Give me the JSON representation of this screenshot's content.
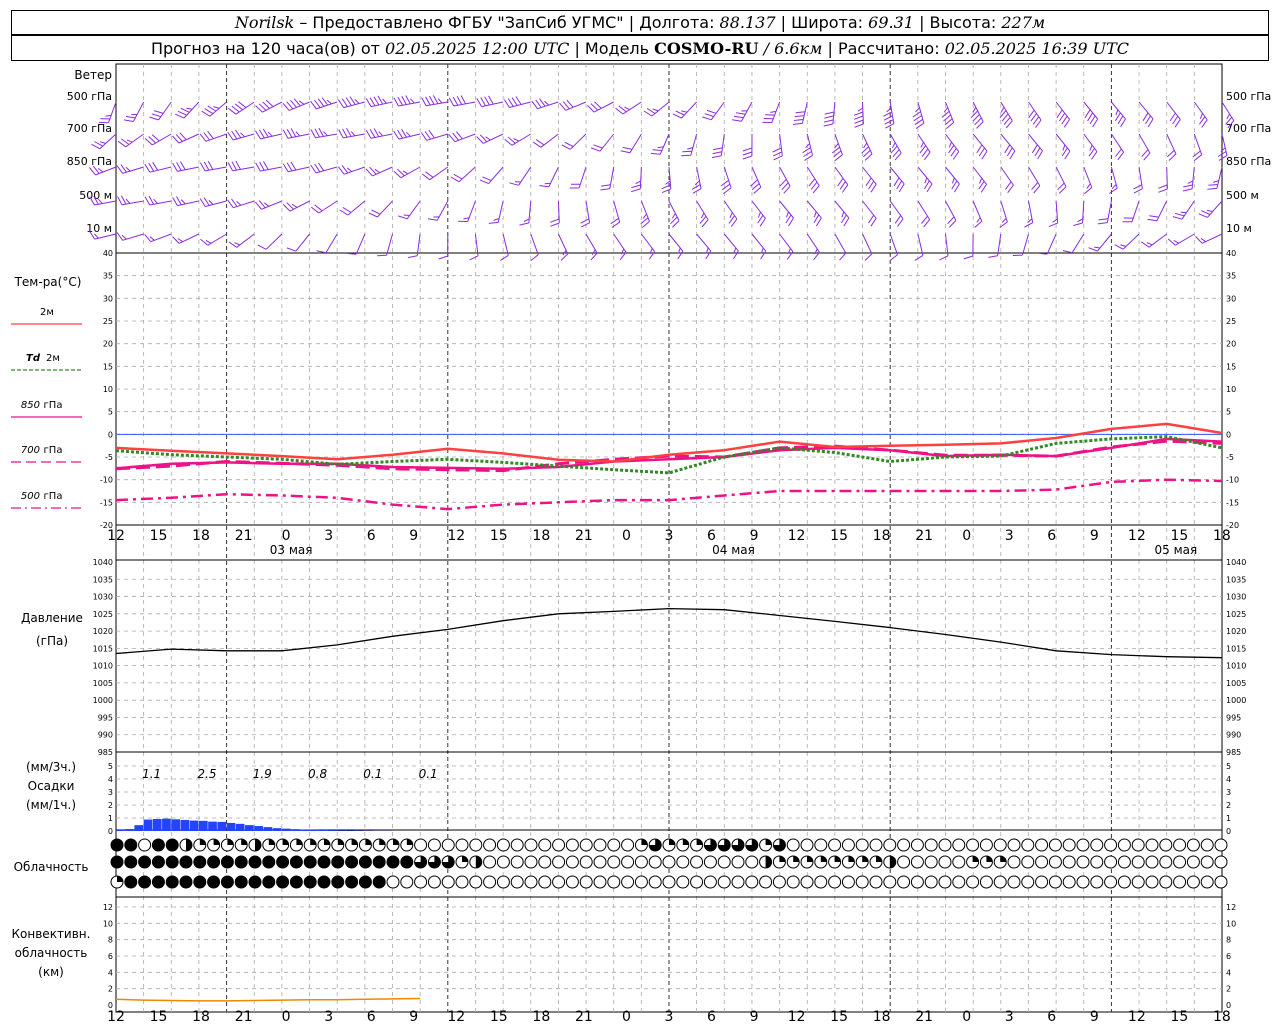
{
  "header": {
    "station": "Norilsk",
    "provider": "– Предоставлено ФГБУ \"ЗапСиб УГМС\"",
    "lon_label": "| Долгота:",
    "lon_value": "88.137",
    "lat_label": "| Широта:",
    "lat_value": "69.31",
    "alt_label": "| Высота:",
    "alt_value": "227м",
    "forecast_prefix": "Прогноз на 120 часа(ов) от",
    "forecast_date": "02.05.2025 12:00 UTC",
    "model_label": "| Модель",
    "model_name": "COSMO-RU",
    "model_res": "/ 6.6км",
    "calc_label": "| Рассчитано:",
    "calc_date": "02.05.2025 16:39 UTC"
  },
  "wind_panel": {
    "title": "Ветер",
    "levels": [
      "500 гПа",
      "700 гПа",
      "850 гПа",
      "500 м",
      "10 м"
    ],
    "right_levels": [
      "500 гПа",
      "700 гПа",
      "850 гПа",
      "500 м",
      "10 м"
    ],
    "barb_color": "#8a2be2"
  },
  "temp_panel": {
    "title": "Тем-ра(°C)",
    "legend": [
      {
        "prefix": "",
        "label": "2м",
        "color": "#ff4040",
        "dash": ""
      },
      {
        "prefix": "Td",
        "label": "2м",
        "color": "#2e8b22",
        "dash": "4,2"
      },
      {
        "prefix": "850",
        "label": "гПа",
        "color": "#ee1188",
        "dash": ""
      },
      {
        "prefix": "700",
        "label": "гПа",
        "color": "#ee1188",
        "dash": "10,5"
      },
      {
        "prefix": "500",
        "label": "гПа",
        "color": "#ee1188",
        "dash": "10,4,2,4"
      }
    ]
  },
  "time_axis": {
    "hour_labels": [
      "12",
      "15",
      "18",
      "21",
      "0",
      "3",
      "6",
      "9",
      "12",
      "15",
      "18",
      "21",
      "0",
      "3",
      "6",
      "9",
      "12",
      "15",
      "18",
      "21",
      "0",
      "3",
      "6",
      "9",
      "12",
      "15",
      "18"
    ],
    "day_labels": [
      "03 мая",
      "04 мая",
      "05 мая"
    ]
  },
  "pressure_panel": {
    "title_line1": "Давление",
    "title_line2": "(гПа)"
  },
  "precip_panel": {
    "title_line1": "(мм/3ч.)",
    "title_line2": "Осадки",
    "title_line3": "(мм/1ч.)",
    "totals_3h": [
      "1.1",
      "2.5",
      "1.9",
      "0.8",
      "0.1",
      "0.1"
    ],
    "bar_color": "#2244ff"
  },
  "cloud_panel": {
    "title": "Облачность",
    "rows": [
      "11.750.50.250.250.250.250.50.250.250.250.250.250.250.250.250.250.250.2500000000000000000.250.750.250.250.250.750.750.750.750.250.75000000000000000000000000000000000000000000",
      "11111111111111111111110.750.750.750.250.5000000000000000000000.50.250.250.250.250.250.250.250.250.5000000.250.250.25000000000000000000000000000000000",
      "0.25111111111111111111100000000000000000000000000000000000000000000000000000000000000000000000000000000000000"
    ]
  },
  "conv_panel": {
    "title_line1": "Конвективн.",
    "title_line2": "облачность",
    "title_line3": "(км)",
    "line_color": "#ee8800"
  },
  "chart_data": [
    {
      "type": "line",
      "panel": "temperature",
      "ylim": [
        -20,
        40
      ],
      "y_ticks": [
        -20,
        -15,
        -10,
        -5,
        0,
        5,
        10,
        15,
        20,
        25,
        30,
        35,
        40
      ],
      "x_hours": [
        0,
        6,
        12,
        18,
        24,
        30,
        36,
        42,
        48,
        54,
        60,
        66,
        72,
        78,
        84,
        90,
        96,
        102,
        108,
        114,
        120
      ],
      "series": [
        {
          "name": "2м",
          "values": [
            -3,
            -3.6,
            -4.2,
            -4.8,
            -5.5,
            -4.5,
            -3.2,
            -4.2,
            -5.6,
            -6,
            -4.5,
            -3.5,
            -1.6,
            -2.8,
            -2.5,
            -2.3,
            -2,
            -0.8,
            1.2,
            2.3,
            0.3
          ]
        },
        {
          "name": "Td 2м",
          "values": [
            -3.6,
            -4.5,
            -5,
            -5.5,
            -6.6,
            -6,
            -5.5,
            -6.2,
            -7,
            -7.8,
            -8.5,
            -5,
            -3,
            -4,
            -6,
            -5,
            -4.8,
            -2,
            -1,
            -0.5,
            -3
          ]
        },
        {
          "name": "850 гПа",
          "values": [
            -7.5,
            -6.5,
            -6.2,
            -6.5,
            -6.5,
            -7.2,
            -7.4,
            -7.6,
            -7.2,
            -6,
            -5.5,
            -5,
            -3.5,
            -3,
            -3.5,
            -4.8,
            -4.5,
            -4.8,
            -3,
            -1,
            -1.6
          ]
        },
        {
          "name": "700 гПа",
          "values": [
            -7.6,
            -7,
            -6,
            -6.4,
            -6.8,
            -7.6,
            -7.8,
            -8,
            -6.5,
            -5.5,
            -4.8,
            -5,
            -3,
            -2.6,
            -3.5,
            -4.6,
            -4.6,
            -4.8,
            -2.8,
            -1.5,
            -2
          ]
        },
        {
          "name": "500 гПа",
          "values": [
            -14.5,
            -14,
            -13.2,
            -13.5,
            -14,
            -15.5,
            -16.5,
            -15.5,
            -15,
            -14.5,
            -14.5,
            -13.5,
            -12.5,
            -12.5,
            -12.5,
            -12.5,
            -12.5,
            -12.2,
            -10.5,
            -10,
            -10.3
          ]
        }
      ]
    },
    {
      "type": "line",
      "panel": "pressure",
      "ylim": [
        985,
        1040
      ],
      "y_ticks": [
        985,
        990,
        995,
        1000,
        1005,
        1010,
        1015,
        1020,
        1025,
        1030,
        1035,
        1040
      ],
      "x_hours": [
        0,
        6,
        12,
        18,
        24,
        30,
        36,
        42,
        48,
        54,
        60,
        66,
        72,
        78,
        84,
        90,
        96,
        102,
        108,
        114,
        120
      ],
      "series": [
        {
          "name": "Давление",
          "values": [
            1013.5,
            1014.8,
            1014.3,
            1014.3,
            1016,
            1018.5,
            1020.5,
            1023,
            1025,
            1025.7,
            1026.5,
            1026.2,
            1024.5,
            1022.8,
            1021,
            1019,
            1016.8,
            1014.3,
            1013.2,
            1012.6,
            1012.3
          ]
        }
      ]
    },
    {
      "type": "bar",
      "panel": "precipitation",
      "ylim": [
        0,
        5
      ],
      "y_ticks": [
        0,
        1,
        2,
        3,
        4,
        5
      ],
      "x_hours": [
        0,
        1,
        2,
        3,
        4,
        5,
        6,
        7,
        8,
        9,
        10,
        11,
        12,
        13,
        14,
        15,
        16,
        17,
        18,
        19,
        20,
        21,
        22,
        23,
        24,
        25,
        26,
        27,
        28,
        29,
        30
      ],
      "values": [
        0.08,
        0.15,
        0.45,
        0.88,
        0.92,
        0.95,
        0.9,
        0.85,
        0.8,
        0.78,
        0.72,
        0.7,
        0.62,
        0.55,
        0.45,
        0.38,
        0.3,
        0.22,
        0.18,
        0.14,
        0.12,
        0.1,
        0.08,
        0.06,
        0.05,
        0.04,
        0.03,
        0.02,
        0.01,
        0.01,
        0
      ]
    },
    {
      "type": "line",
      "panel": "convective_cloud",
      "ylim": [
        0,
        13
      ],
      "y_ticks": [
        0,
        2,
        4,
        6,
        8,
        10,
        12
      ],
      "x_hours": [
        0,
        3,
        6,
        9,
        12,
        15,
        18,
        21,
        24,
        27,
        30,
        33
      ],
      "series": [
        {
          "name": "Конвективная облачность",
          "values": [
            0.7,
            0.6,
            0.55,
            0.5,
            0.5,
            0.55,
            0.6,
            0.65,
            0.65,
            0.7,
            0.75,
            0.8
          ]
        }
      ]
    }
  ]
}
